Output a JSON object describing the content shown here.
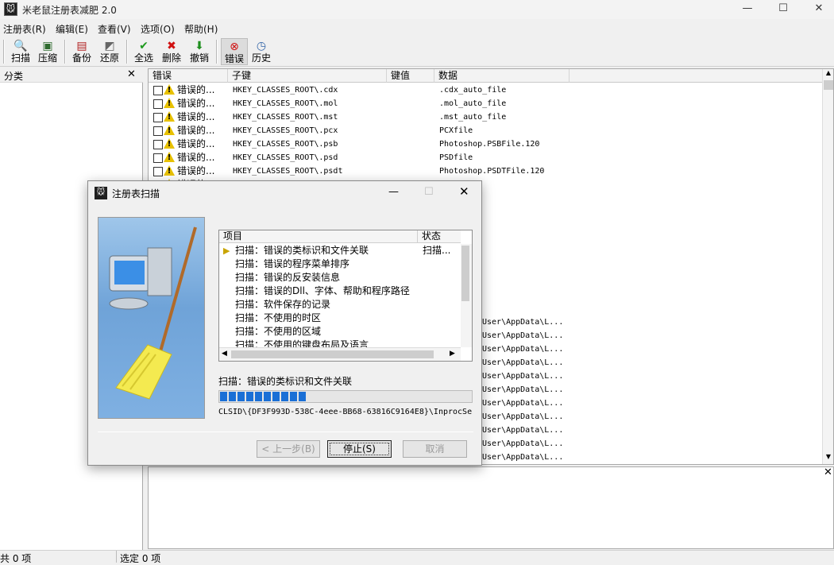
{
  "window": {
    "title": "米老鼠注册表减肥 2.0",
    "icon": "mouse-app-icon",
    "controls": {
      "minimize": "—",
      "maximize": "☐",
      "close": "✕"
    }
  },
  "menu": [
    "注册表(R)",
    "编辑(E)",
    "查看(V)",
    "选项(O)",
    "帮助(H)"
  ],
  "toolbar": {
    "buttons": [
      {
        "label": "扫描",
        "icon": "magnifier-icon"
      },
      {
        "label": "压缩",
        "icon": "compress-icon"
      },
      {
        "label": "备份",
        "icon": "backup-icon"
      },
      {
        "label": "还原",
        "icon": "restore-icon"
      },
      {
        "label": "全选",
        "icon": "check-icon"
      },
      {
        "label": "删除",
        "icon": "delete-x-icon"
      },
      {
        "label": "撤销",
        "icon": "undo-arrow-icon"
      },
      {
        "label": "错误",
        "icon": "error-icon"
      },
      {
        "label": "历史",
        "icon": "history-icon"
      }
    ]
  },
  "left_pane": {
    "title": "分类",
    "close": "✕"
  },
  "table": {
    "columns": [
      "错误",
      "子键",
      "键值",
      "数据"
    ],
    "rows": [
      {
        "err": "错误的...",
        "key": "HKEY_CLASSES_ROOT\\.cdx",
        "value": "",
        "data": ".cdx_auto_file"
      },
      {
        "err": "错误的...",
        "key": "HKEY_CLASSES_ROOT\\.mol",
        "value": "",
        "data": ".mol_auto_file"
      },
      {
        "err": "错误的...",
        "key": "HKEY_CLASSES_ROOT\\.mst",
        "value": "",
        "data": ".mst_auto_file"
      },
      {
        "err": "错误的...",
        "key": "HKEY_CLASSES_ROOT\\.pcx",
        "value": "",
        "data": "PCXfile"
      },
      {
        "err": "错误的...",
        "key": "HKEY_CLASSES_ROOT\\.psb",
        "value": "",
        "data": "Photoshop.PSBFile.120"
      },
      {
        "err": "错误的...",
        "key": "HKEY_CLASSES_ROOT\\.psd",
        "value": "",
        "data": "PSDfile"
      },
      {
        "err": "错误的...",
        "key": "HKEY_CLASSES_ROOT\\.psdt",
        "value": "",
        "data": "Photoshop.PSDTFile.120"
      },
      {
        "err": "错误的...",
        "key": "",
        "value": "",
        "data": "_file"
      },
      {
        "err": "",
        "key": "",
        "value": "",
        "data": "_file"
      },
      {
        "err": "",
        "key": "",
        "value": "",
        "data": "_file"
      },
      {
        "err": "",
        "key": "",
        "value": "",
        "data": "_file"
      }
    ],
    "partial_rows": [
      "User\\AppData\\L...",
      "User\\AppData\\L...",
      "User\\AppData\\L...",
      "User\\AppData\\L...",
      "User\\AppData\\L...",
      "User\\AppData\\L...",
      "User\\AppData\\L...",
      "User\\AppData\\L...",
      "User\\AppData\\L...",
      "User\\AppData\\L...",
      "User\\AppData\\L...",
      "User\\AppData\\L..."
    ]
  },
  "detail_pane": {
    "close": "✕"
  },
  "statusbar": {
    "total": "共 0 项",
    "selected": "选定 0 项"
  },
  "dialog": {
    "title": "注册表扫描",
    "close": "✕",
    "list_columns": [
      "项目",
      "状态"
    ],
    "items": [
      {
        "text": "扫描：错误的类标识和文件关联",
        "status": "扫描..."
      },
      {
        "text": "扫描：错误的程序菜单排序",
        "status": ""
      },
      {
        "text": "扫描：错误的反安装信息",
        "status": ""
      },
      {
        "text": "扫描：错误的Dll、字体、帮助和程序路径",
        "status": ""
      },
      {
        "text": "扫描：软件保存的记录",
        "status": ""
      },
      {
        "text": "扫描：不使用的时区",
        "status": ""
      },
      {
        "text": "扫描：不使用的区域",
        "status": ""
      },
      {
        "text": "扫描：不使用的键盘布局及语言",
        "status": ""
      }
    ],
    "current": "扫描：错误的类标识和文件关联",
    "progress": 0.37,
    "path": "CLSID\\{DF3F993D-538C-4eee-BB68-63816C9164E8}\\InprocSer",
    "buttons": {
      "back": "< 上一步(B)",
      "stop": "停止(S)",
      "cancel": "取消"
    }
  }
}
